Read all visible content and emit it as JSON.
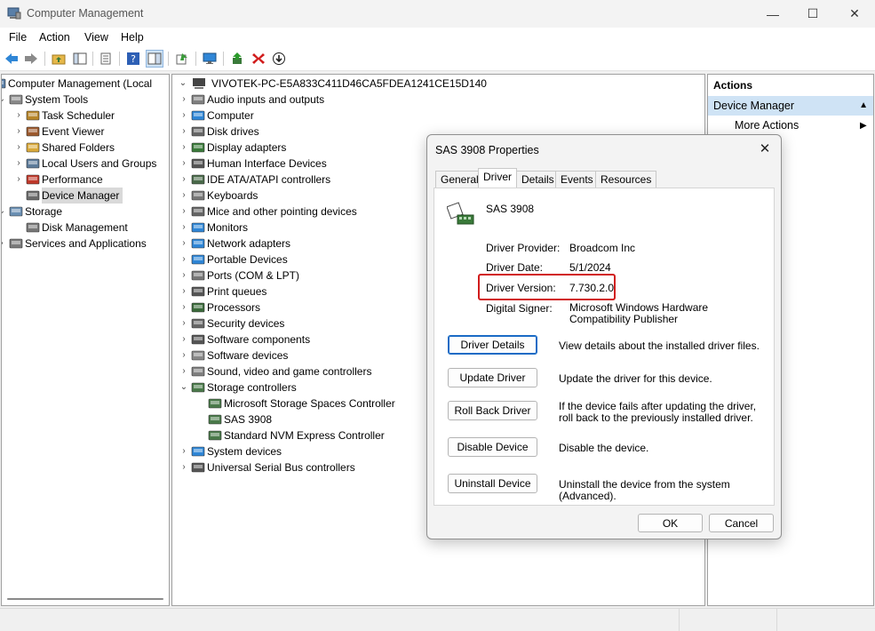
{
  "window": {
    "title": "Computer Management",
    "minimize": "—",
    "maximize": "☐",
    "close": "✕"
  },
  "menu": [
    "File",
    "Action",
    "View",
    "Help"
  ],
  "left_tree": [
    {
      "label": "Computer Management (Local",
      "indent": 0,
      "chev": "",
      "icon": "computer-management-icon",
      "color": "#5a7fa8"
    },
    {
      "label": "System Tools",
      "indent": 1,
      "chev": "⌄",
      "icon": "system-tools-icon",
      "color": "#8a8a8a"
    },
    {
      "label": "Task Scheduler",
      "indent": 2,
      "chev": "›",
      "icon": "clock-icon",
      "color": "#b7862a"
    },
    {
      "label": "Event Viewer",
      "indent": 2,
      "chev": "›",
      "icon": "event-viewer-icon",
      "color": "#9c5a2e"
    },
    {
      "label": "Shared Folders",
      "indent": 2,
      "chev": "›",
      "icon": "shared-folder-icon",
      "color": "#d9a93a"
    },
    {
      "label": "Local Users and Groups",
      "indent": 2,
      "chev": "›",
      "icon": "users-icon",
      "color": "#5d7b9a"
    },
    {
      "label": "Performance",
      "indent": 2,
      "chev": "›",
      "icon": "performance-icon",
      "color": "#c0392b"
    },
    {
      "label": "Device Manager",
      "indent": 2,
      "chev": "",
      "icon": "device-manager-icon",
      "color": "#6b6b6b",
      "selected": true
    },
    {
      "label": "Storage",
      "indent": 1,
      "chev": "⌄",
      "icon": "storage-icon",
      "color": "#6a8fb3"
    },
    {
      "label": "Disk Management",
      "indent": 2,
      "chev": "",
      "icon": "disk-management-icon",
      "color": "#777777"
    },
    {
      "label": "Services and Applications",
      "indent": 1,
      "chev": "›",
      "icon": "services-icon",
      "color": "#7a7a7a"
    }
  ],
  "device_tree": {
    "root": "VIVOTEK-PC-E5A833C411D46CA5FDEA1241CE15D140",
    "items": [
      {
        "label": "Audio inputs and outputs",
        "indent": 1,
        "chev": "›",
        "icon": "speaker-icon",
        "color": "#808080"
      },
      {
        "label": "Computer",
        "indent": 1,
        "chev": "›",
        "icon": "monitor-icon",
        "color": "#2f86d6"
      },
      {
        "label": "Disk drives",
        "indent": 1,
        "chev": "›",
        "icon": "disk-drive-icon",
        "color": "#666666"
      },
      {
        "label": "Display adapters",
        "indent": 1,
        "chev": "›",
        "icon": "display-adapter-icon",
        "color": "#3a7a3a"
      },
      {
        "label": "Human Interface Devices",
        "indent": 1,
        "chev": "›",
        "icon": "hid-icon",
        "color": "#555555"
      },
      {
        "label": "IDE ATA/ATAPI controllers",
        "indent": 1,
        "chev": "›",
        "icon": "ide-controller-icon",
        "color": "#4a6a4a"
      },
      {
        "label": "Keyboards",
        "indent": 1,
        "chev": "›",
        "icon": "keyboard-icon",
        "color": "#777777"
      },
      {
        "label": "Mice and other pointing devices",
        "indent": 1,
        "chev": "›",
        "icon": "mouse-icon",
        "color": "#666666"
      },
      {
        "label": "Monitors",
        "indent": 1,
        "chev": "›",
        "icon": "monitor-icon",
        "color": "#2f86d6"
      },
      {
        "label": "Network adapters",
        "indent": 1,
        "chev": "›",
        "icon": "network-icon",
        "color": "#2f86d6"
      },
      {
        "label": "Portable Devices",
        "indent": 1,
        "chev": "›",
        "icon": "portable-device-icon",
        "color": "#2f86d6"
      },
      {
        "label": "Ports (COM & LPT)",
        "indent": 1,
        "chev": "›",
        "icon": "port-icon",
        "color": "#777777"
      },
      {
        "label": "Print queues",
        "indent": 1,
        "chev": "›",
        "icon": "printer-icon",
        "color": "#555555"
      },
      {
        "label": "Processors",
        "indent": 1,
        "chev": "›",
        "icon": "processor-icon",
        "color": "#3a6a3a"
      },
      {
        "label": "Security devices",
        "indent": 1,
        "chev": "›",
        "icon": "security-icon",
        "color": "#666666"
      },
      {
        "label": "Software components",
        "indent": 1,
        "chev": "›",
        "icon": "software-component-icon",
        "color": "#555555"
      },
      {
        "label": "Software devices",
        "indent": 1,
        "chev": "›",
        "icon": "software-device-icon",
        "color": "#888888"
      },
      {
        "label": "Sound, video and game controllers",
        "indent": 1,
        "chev": "›",
        "icon": "speaker-icon",
        "color": "#808080"
      },
      {
        "label": "Storage controllers",
        "indent": 1,
        "chev": "⌄",
        "icon": "storage-controller-icon",
        "color": "#4a7a4a"
      },
      {
        "label": "Microsoft Storage Spaces Controller",
        "indent": 2,
        "chev": "",
        "icon": "storage-controller-icon",
        "color": "#4a7a4a"
      },
      {
        "label": "SAS 3908",
        "indent": 2,
        "chev": "",
        "icon": "storage-controller-icon",
        "color": "#4a7a4a"
      },
      {
        "label": "Standard NVM Express Controller",
        "indent": 2,
        "chev": "",
        "icon": "storage-controller-icon",
        "color": "#4a7a4a"
      },
      {
        "label": "System devices",
        "indent": 1,
        "chev": "›",
        "icon": "system-device-icon",
        "color": "#2f86d6"
      },
      {
        "label": "Universal Serial Bus controllers",
        "indent": 1,
        "chev": "›",
        "icon": "usb-icon",
        "color": "#555555"
      }
    ]
  },
  "actions": {
    "header": "Actions",
    "section": "Device Manager",
    "more": "More Actions"
  },
  "dialog": {
    "title": "SAS 3908 Properties",
    "close": "✕",
    "tabs": [
      "General",
      "Driver",
      "Details",
      "Events",
      "Resources"
    ],
    "active_tab": "Driver",
    "device_name": "SAS 3908",
    "props": [
      {
        "label": "Driver Provider:",
        "value": "Broadcom Inc"
      },
      {
        "label": "Driver Date:",
        "value": "5/1/2024"
      },
      {
        "label": "Driver Version:",
        "value": "7.730.2.0"
      },
      {
        "label": "Digital Signer:",
        "value": "Microsoft Windows Hardware Compatibility Publisher"
      }
    ],
    "buttons": [
      {
        "label": "Driver Details",
        "desc": "View details about the installed driver files."
      },
      {
        "label": "Update Driver",
        "desc": "Update the driver for this device."
      },
      {
        "label": "Roll Back Driver",
        "desc": "If the device fails after updating the driver, roll back to the previously installed driver."
      },
      {
        "label": "Disable Device",
        "desc": "Disable the device."
      },
      {
        "label": "Uninstall Device",
        "desc": "Uninstall the device from the system (Advanced)."
      }
    ],
    "ok": "OK",
    "cancel": "Cancel"
  },
  "colors": {
    "highlight": "#d11c1c",
    "selection": "#d9d9d9",
    "actions_section": "#cfe3f5",
    "accent": "#1a6bc5"
  }
}
